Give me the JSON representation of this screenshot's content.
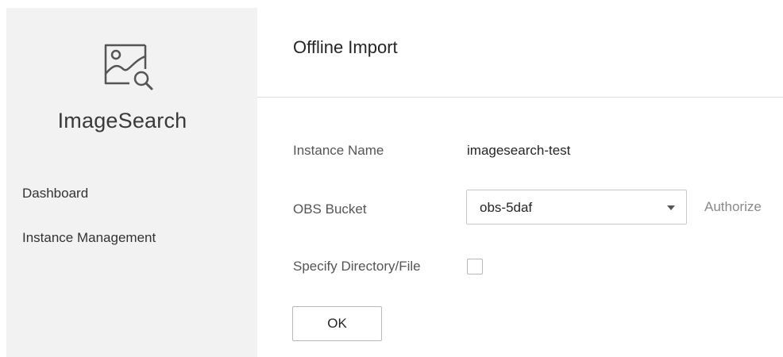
{
  "sidebar": {
    "logo_icon": "image-search-icon",
    "app_name": "ImageSearch",
    "items": [
      {
        "label": "Dashboard"
      },
      {
        "label": "Instance Management"
      }
    ]
  },
  "main": {
    "title": "Offline Import",
    "form": {
      "instance_name_label": "Instance Name",
      "instance_name_value": "imagesearch-test",
      "obs_bucket_label": "OBS Bucket",
      "obs_bucket_value": "obs-5daf",
      "authorize_label": "Authorize",
      "specify_label": "Specify Directory/File",
      "specify_checked": false,
      "ok_label": "OK"
    }
  },
  "colors": {
    "sidebar_bg": "#f2f2f2",
    "border": "#c8c8c8",
    "link_muted": "#8a8a8a"
  }
}
